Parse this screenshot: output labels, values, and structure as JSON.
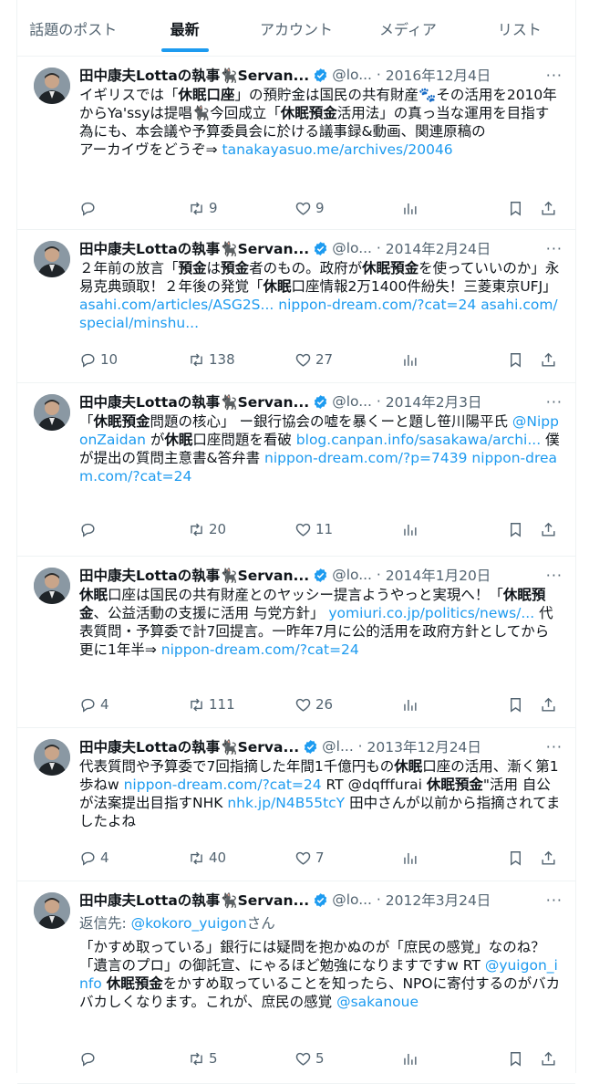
{
  "tabs": [
    "話題のポスト",
    "最新",
    "アカウント",
    "メディア",
    "リスト"
  ],
  "active_tab": 1,
  "colors": {
    "accent": "#1d9bf0",
    "text": "#0f1419",
    "secondary": "#536471",
    "border": "#eff3f4"
  },
  "posts": [
    {
      "name": "田中康夫Lottaの執事🐈‍⬛Servan...",
      "handle": "@lo...",
      "date": "2016年12月4日",
      "more": "···",
      "segments": [
        {
          "t": "イギリスでは「"
        },
        {
          "t": "休眠口座",
          "b": true
        },
        {
          "t": "」の預貯金は国民の共有財産🐾その活用を2010年からYa'ssyは提唱🐈‍⬛今回成立「"
        },
        {
          "t": "休眠預金",
          "b": true
        },
        {
          "t": "活用法」の真っ当な運用を目指す為にも、本会議や予算委員会に於ける議事録&動画、関連原稿の\nアーカイヴをどうぞ⇒ "
        },
        {
          "t": "tanakayasuo.me/archives/20046",
          "link": true
        }
      ],
      "stats": {
        "reply": "",
        "retweet": "9",
        "like": "9"
      }
    },
    {
      "name": "田中康夫Lottaの執事🐈‍⬛Servan...",
      "handle": "@lo...",
      "date": "2014年2月24日",
      "more": "···",
      "segments": [
        {
          "t": "２年前の放言「"
        },
        {
          "t": "預金",
          "b": true
        },
        {
          "t": "は"
        },
        {
          "t": "預金",
          "b": true
        },
        {
          "t": "者のもの。政府が"
        },
        {
          "t": "休眠預金",
          "b": true
        },
        {
          "t": "を使っていいのか」永易克典頭取！２年後の発覚「"
        },
        {
          "t": "休眠",
          "b": true
        },
        {
          "t": "口座情報2万1400件紛失！三菱東京UFJ」 "
        },
        {
          "t": "asahi.com/articles/ASG2S...",
          "link": true
        },
        {
          "t": " "
        },
        {
          "t": "nippon-dream.com/?cat=24",
          "link": true
        },
        {
          "t": " "
        },
        {
          "t": "asahi.com/special/minshu...",
          "link": true
        }
      ],
      "stats": {
        "reply": "10",
        "retweet": "138",
        "like": "27"
      }
    },
    {
      "name": "田中康夫Lottaの執事🐈‍⬛Servan...",
      "handle": "@lo...",
      "date": "2014年2月3日",
      "more": "···",
      "segments": [
        {
          "t": "「"
        },
        {
          "t": "休眠預金",
          "b": true
        },
        {
          "t": "問題の核心」 ー銀行協会の嘘を暴くーと題し笹川陽平氏 "
        },
        {
          "t": "@NipponZaidan",
          "link": true
        },
        {
          "t": " が"
        },
        {
          "t": "休眠",
          "b": true
        },
        {
          "t": "口座問題を看破 "
        },
        {
          "t": "blog.canpan.info/sasakawa/archi...",
          "link": true
        },
        {
          "t": " 僕が提出の質問主意書&答弁書 "
        },
        {
          "t": "nippon-dream.com/?p=7439",
          "link": true
        },
        {
          "t": " "
        },
        {
          "t": "nippon-dream.com/?cat=24",
          "link": true
        }
      ],
      "stats": {
        "reply": "",
        "retweet": "20",
        "like": "11"
      }
    },
    {
      "name": "田中康夫Lottaの執事🐈‍⬛Servan...",
      "handle": "@lo...",
      "date": "2014年1月20日",
      "more": "···",
      "segments": [
        {
          "t": "休眠",
          "b": true
        },
        {
          "t": "口座は国民の共有財産とのヤッシー提言ようやっと実現へ！「"
        },
        {
          "t": "休眠預金",
          "b": true
        },
        {
          "t": "、公益活動の支援に活用 与党方針」 "
        },
        {
          "t": "yomiuri.co.jp/politics/news/...",
          "link": true
        },
        {
          "t": " 代表質問・予算委で計7回提言。一昨年7月に公的活用を政府方針としてから更に1年半⇒ "
        },
        {
          "t": "nippon-dream.com/?cat=24",
          "link": true
        }
      ],
      "stats": {
        "reply": "4",
        "retweet": "111",
        "like": "26"
      }
    },
    {
      "name": "田中康夫Lottaの執事🐈‍⬛Serva...",
      "handle": "@l...",
      "date": "2013年12月24日",
      "more": "···",
      "segments": [
        {
          "t": "代表質問や予算委で7回指摘した年間1千億円もの"
        },
        {
          "t": "休眠",
          "b": true
        },
        {
          "t": "口座の活用、漸く第1歩ねw "
        },
        {
          "t": "nippon-dream.com/?cat=24",
          "link": true
        },
        {
          "t": " RT @dqfffurai "
        },
        {
          "t": "休眠預金",
          "b": true
        },
        {
          "t": "\"活用 自公が法案提出目指すNHK "
        },
        {
          "t": "nhk.jp/N4B55tcY",
          "link": true
        },
        {
          "t": " 田中さんが以前から指摘されてましたよね"
        }
      ],
      "stats": {
        "reply": "4",
        "retweet": "40",
        "like": "7"
      }
    },
    {
      "name": "田中康夫Lottaの執事🐈‍⬛Servan...",
      "handle": "@lo...",
      "date": "2012年3月24日",
      "more": "···",
      "reply_prefix": "返信先: ",
      "reply_to": "@kokoro_yuigon",
      "reply_suffix": "さん",
      "segments": [
        {
          "t": "「かすめ取っている」銀行には疑問を抱かぬのが「庶民の感覚」なのね？「遺言のプロ」の御託宣、にゃるほど勉強になりますですw RT "
        },
        {
          "t": "@yuigon_info",
          "link": true
        },
        {
          "t": " "
        },
        {
          "t": "休眠預金",
          "b": true
        },
        {
          "t": "をかすめ取っていることを知ったら、NPOに寄付するのがバカバカしくなります。これが、庶民の感覚 "
        },
        {
          "t": "@sakanoue",
          "link": true
        }
      ],
      "stats": {
        "reply": "",
        "retweet": "5",
        "like": "5"
      }
    }
  ]
}
